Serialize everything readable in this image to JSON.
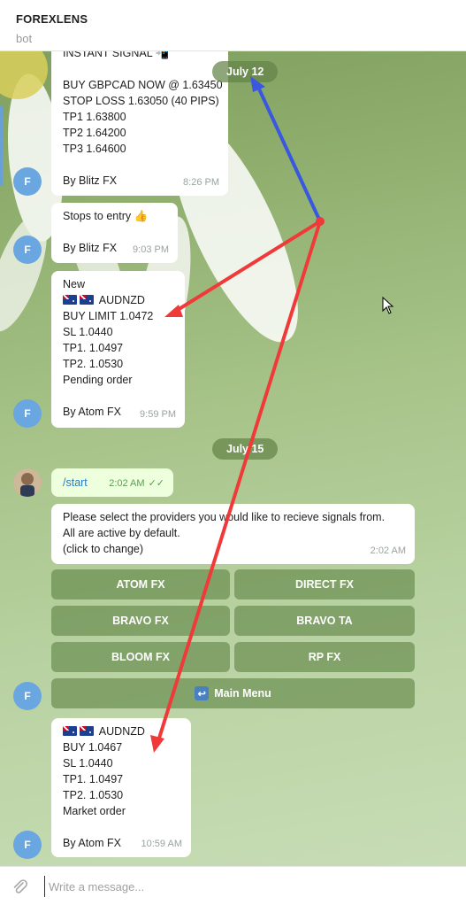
{
  "header": {
    "title": "FOREXLENS",
    "subtitle": "bot"
  },
  "messages": {
    "m1": {
      "lines": [
        "INSTANT SIGNAL",
        "",
        "BUY GBPCAD NOW @ 1.63450",
        "STOP LOSS 1.63050 (40 PIPS)",
        "TP1 1.63800",
        "TP2 1.64200",
        "TP3 1.64600",
        "",
        "By Blitz FX"
      ],
      "time": "8:26 PM"
    },
    "m2": {
      "lines": [
        "Stops to entry 👍",
        "",
        "By Blitz FX"
      ],
      "time": "9:03 PM"
    },
    "m3": {
      "lines": [
        "New",
        "AUDNZD",
        "BUY LIMIT 1.0472",
        "SL 1.0440",
        "TP1. 1.0497",
        "TP2. 1.0530",
        "Pending order",
        "",
        "By Atom FX"
      ],
      "time": "9:59 PM"
    },
    "m4": {
      "text": "/start",
      "time": "2:02 AM"
    },
    "m5": {
      "lines": [
        "Please select the providers you would like to recieve signals from.",
        "All are active by default.",
        "(click to change)"
      ],
      "time": "2:02 AM"
    },
    "m6": {
      "lines": [
        "AUDNZD",
        "BUY 1.0467",
        "SL 1.0440",
        "TP1. 1.0497",
        "TP2. 1.0530",
        "Market order",
        "",
        "By Atom FX"
      ],
      "time": "10:59 AM"
    }
  },
  "dates": {
    "d1": "July 12",
    "d2": "July 15"
  },
  "avatar_letter": "F",
  "keyboard": {
    "atom": "ATOM FX",
    "direct": "DIRECT FX",
    "bravo": "BRAVO FX",
    "bravo_ta": "BRAVO TA",
    "bloom": "BLOOM FX",
    "rp": "RP FX",
    "main_menu": "Main Menu"
  },
  "composer": {
    "placeholder": "Write a message..."
  },
  "icons": {
    "attach": "paperclip-icon",
    "read": "double-check-icon",
    "menu": "return-arrow-icon",
    "signal": "phone-icon"
  },
  "colors": {
    "accent": "#6aa6e0",
    "annotation_red": "#f03a3a",
    "annotation_blue": "#3a57e0",
    "outgoing": "#eeffde"
  }
}
